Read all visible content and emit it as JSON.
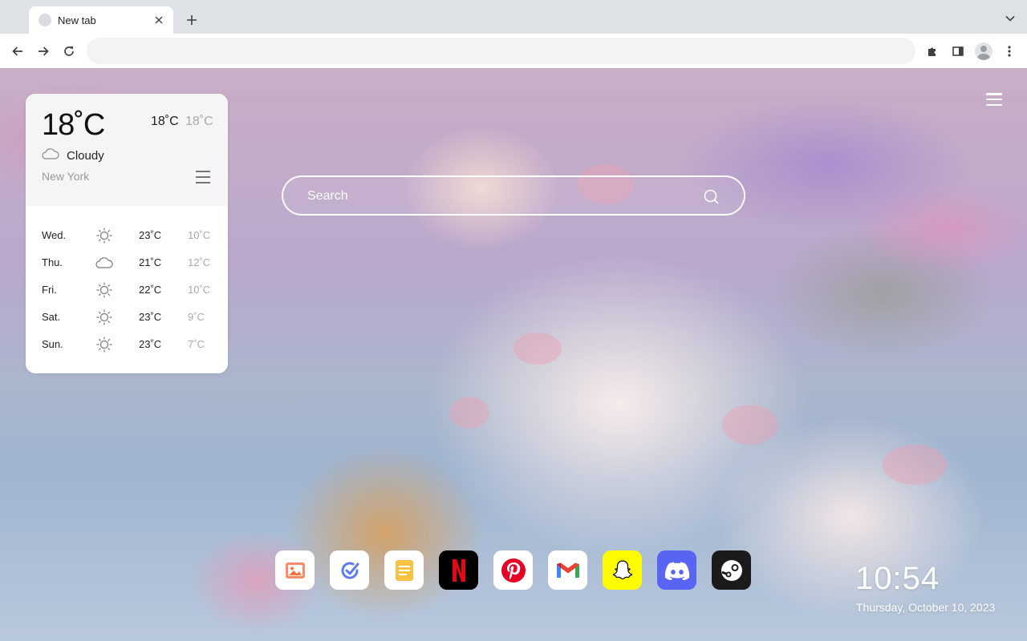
{
  "browser": {
    "tab_title": "New tab",
    "omnibox_value": "",
    "omnibox_placeholder": ""
  },
  "weather": {
    "current_temp": "18˚C",
    "high": "18˚C",
    "low": "18˚C",
    "condition": "Cloudy",
    "condition_icon": "cloud-icon",
    "city": "New York",
    "forecast": [
      {
        "day": "Wed.",
        "icon": "sun-icon",
        "high": "23˚C",
        "low": "10˚C"
      },
      {
        "day": "Thu.",
        "icon": "cloud-icon",
        "high": "21˚C",
        "low": "12˚C"
      },
      {
        "day": "Fri.",
        "icon": "sun-icon",
        "high": "22˚C",
        "low": "10˚C"
      },
      {
        "day": "Sat.",
        "icon": "sun-icon",
        "high": "23˚C",
        "low": "9˚C"
      },
      {
        "day": "Sun.",
        "icon": "sun-icon",
        "high": "23˚C",
        "low": "7˚C"
      }
    ]
  },
  "search": {
    "placeholder": "Search"
  },
  "dock": {
    "apps": [
      {
        "name": "gallery",
        "icon": "image-icon",
        "bg": "#ffffff"
      },
      {
        "name": "tasks",
        "icon": "check-icon",
        "bg": "#ffffff"
      },
      {
        "name": "notes",
        "icon": "note-icon",
        "bg": "#ffffff"
      },
      {
        "name": "netflix",
        "icon": "netflix-icon",
        "bg": "#000000"
      },
      {
        "name": "pinterest",
        "icon": "pinterest-icon",
        "bg": "#ffffff"
      },
      {
        "name": "gmail",
        "icon": "gmail-icon",
        "bg": "#ffffff"
      },
      {
        "name": "snapchat",
        "icon": "snapchat-icon",
        "bg": "#fffc00"
      },
      {
        "name": "discord",
        "icon": "discord-icon",
        "bg": "#5865f2"
      },
      {
        "name": "steam",
        "icon": "steam-icon",
        "bg": "#1b1b1b"
      }
    ]
  },
  "clock": {
    "time": "10:54",
    "date": "Thursday, October 10, 2023"
  },
  "colors": {
    "tabstrip": "#dee1e6",
    "accent_netflix": "#e50914",
    "accent_pinterest": "#e60023",
    "accent_discord": "#5865f2"
  }
}
